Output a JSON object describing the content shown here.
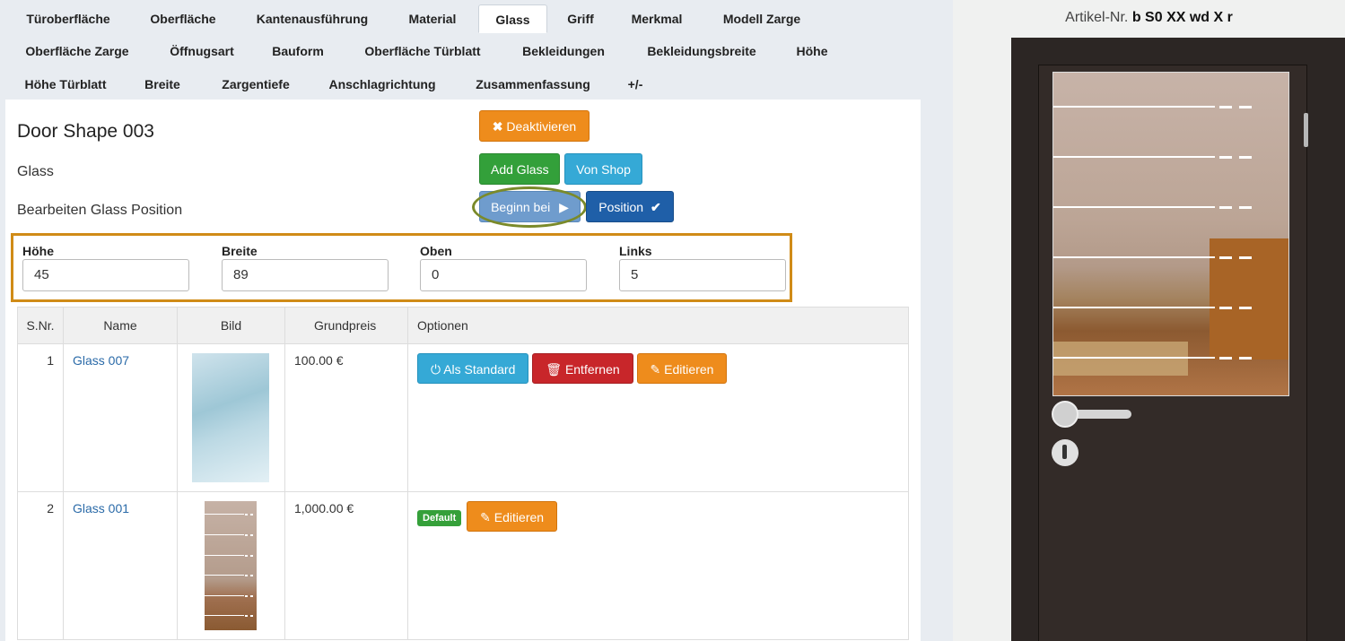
{
  "tabs": {
    "row1": [
      "Türoberfläche",
      "Oberfläche",
      "Kantenausführung",
      "Material",
      "Glass",
      "Griff",
      "Merkmal",
      "Modell Zarge"
    ],
    "row2": [
      "Oberfläche Zarge",
      "Öffnugsart",
      "Bauform",
      "Oberfläche Türblatt",
      "Bekleidungen",
      "Bekleidungsbreite",
      "Höhe"
    ],
    "row3": [
      "Höhe Türblatt",
      "Breite",
      "Zargentiefe",
      "Anschlagrichtung",
      "Zusammenfassung",
      "+/-"
    ],
    "active": "Glass"
  },
  "main": {
    "title": "Door Shape 003",
    "section": "Glass",
    "subsection": "Bearbeiten Glass Position",
    "buttons": {
      "deactivate": "Deaktivieren",
      "add_glass": "Add Glass",
      "from_shop": "Von Shop",
      "start_at": "Beginn bei",
      "position": "Position"
    },
    "fields": [
      {
        "label": "Höhe",
        "value": "45"
      },
      {
        "label": "Breite",
        "value": "89"
      },
      {
        "label": "Oben",
        "value": "0"
      },
      {
        "label": "Links",
        "value": "5"
      }
    ]
  },
  "table": {
    "headers": [
      "S.Nr.",
      "Name",
      "Bild",
      "Grundpreis",
      "Optionen"
    ],
    "rows": [
      {
        "nr": "1",
        "name": "Glass 007",
        "price": "100.00 €",
        "is_default": false
      },
      {
        "nr": "2",
        "name": "Glass 001",
        "price": "1,000.00 €",
        "is_default": true
      }
    ],
    "actions": {
      "set_default": "Als Standard",
      "remove": "Entfernen",
      "edit": "Editieren",
      "default_badge": "Default"
    }
  },
  "preview": {
    "article_label": "Artikel-Nr.",
    "article_code": "b S0 XX wd X r"
  },
  "icons": {
    "deactivate": "times-icon",
    "start_at": "play-icon",
    "position": "check-icon",
    "set_default": "power-icon",
    "remove": "trash-icon",
    "edit": "edit-icon"
  }
}
